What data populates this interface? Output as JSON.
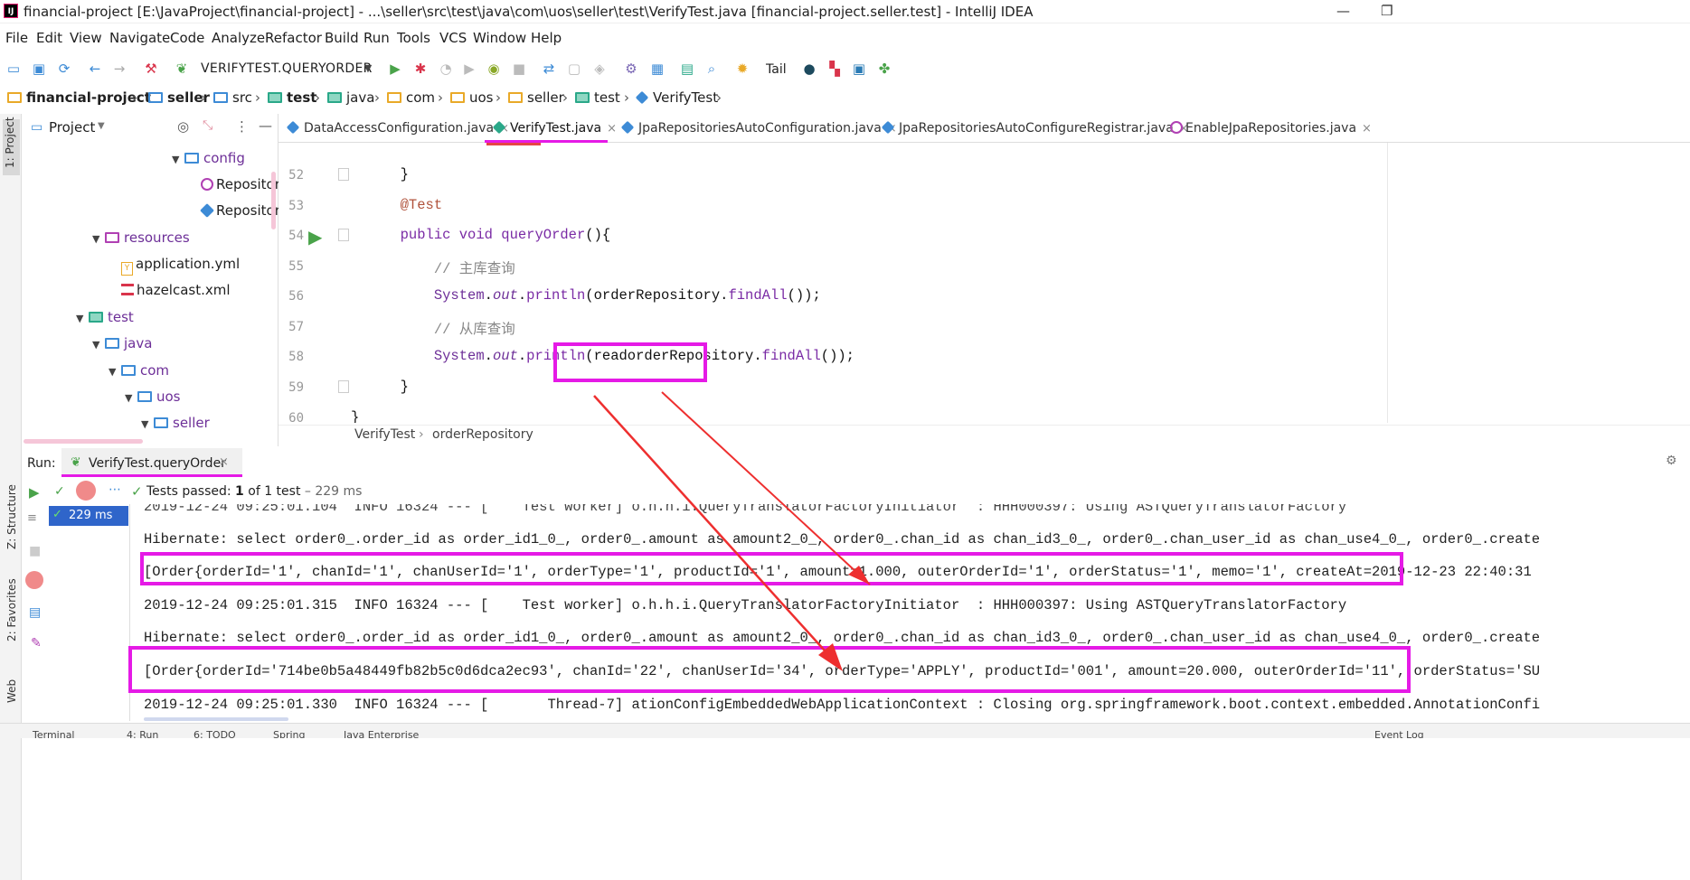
{
  "window": {
    "title": "financial-project [E:\\JavaProject\\financial-project] - ...\\seller\\src\\test\\java\\com\\uos\\seller\\test\\VerifyTest.java [financial-project.seller.test] - IntelliJ IDEA",
    "minimize": "—",
    "restore": "❐",
    "close": "✕"
  },
  "menu": [
    "File",
    "Edit",
    "View",
    "Navigate",
    "Code",
    "Analyze",
    "Refactor",
    "Build",
    "Run",
    "Tools",
    "VCS",
    "Window",
    "Help"
  ],
  "toolbar": {
    "run_config": "VERIFYTEST.QUERYORDER",
    "tail": "Tail"
  },
  "breadcrumb": [
    "financial-project",
    "seller",
    "src",
    "test",
    "java",
    "com",
    "uos",
    "seller",
    "test",
    "VerifyTest"
  ],
  "left_strip": {
    "project": "1: Project",
    "structure": "Z: Structure",
    "favorites": "2: Favorites",
    "web": "Web"
  },
  "project": {
    "header": "Project",
    "tree": [
      {
        "label": "config",
        "level": 6,
        "type": "folder",
        "expanded": true
      },
      {
        "label": "Repository",
        "level": 8,
        "type": "annotation"
      },
      {
        "label": "Repository",
        "level": 8,
        "type": "class"
      },
      {
        "label": "resources",
        "level": 4,
        "type": "folder",
        "expanded": true
      },
      {
        "label": "application.yml",
        "level": 6,
        "type": "yml"
      },
      {
        "label": "hazelcast.xml",
        "level": 6,
        "type": "xml"
      },
      {
        "label": "test",
        "level": 3,
        "type": "folder",
        "expanded": true
      },
      {
        "label": "java",
        "level": 4,
        "type": "folder",
        "expanded": true
      },
      {
        "label": "com",
        "level": 5,
        "type": "folder",
        "expanded": true
      },
      {
        "label": "uos",
        "level": 6,
        "type": "folder",
        "expanded": true
      },
      {
        "label": "seller",
        "level": 7,
        "type": "folder",
        "expanded": true
      }
    ]
  },
  "tabs": [
    {
      "label": "DataAccessConfiguration.java",
      "active": false
    },
    {
      "label": "VerifyTest.java",
      "active": true
    },
    {
      "label": "JpaRepositoriesAutoConfiguration.java",
      "active": false
    },
    {
      "label": "JpaRepositoriesAutoConfigureRegistrar.java",
      "active": false
    },
    {
      "label": "EnableJpaRepositories.java",
      "active": false
    }
  ],
  "editor": {
    "lines": [
      {
        "n": "52",
        "code": "}"
      },
      {
        "n": "53",
        "code": "@Test"
      },
      {
        "n": "54",
        "code": "public void queryOrder(){"
      },
      {
        "n": "55",
        "code": "// 主库查询"
      },
      {
        "n": "56",
        "code": "System.out.println(orderRepository.findAll());"
      },
      {
        "n": "57",
        "code": "// 从库查询"
      },
      {
        "n": "58",
        "code": "System.out.println(readorderRepository.findAll());"
      },
      {
        "n": "59",
        "code": "}"
      },
      {
        "n": "60",
        "code": "}"
      }
    ],
    "tokens": {
      "system": "System",
      "out": "out",
      "println": "println",
      "findall": "findAll",
      "repo1": "orderRepository",
      "repo2": "readorderRepository",
      "kw_public": "public",
      "kw_void": "void",
      "method": "queryOrder",
      "ann": "@Test",
      "cmt1": "// 主库查询",
      "cmt2": "// 从库查询"
    },
    "breadcrumbs": [
      "VerifyTest",
      "orderRepository"
    ]
  },
  "run": {
    "label": "Run:",
    "tab": "VerifyTest.queryOrder",
    "status_pre": "Tests passed: ",
    "status_bold": "1",
    "status_mid": " of 1 test",
    "status_time": " – 229 ms",
    "tree_time": "229 ms",
    "console": [
      "2019-12-24 09:25:01.104  INFO 16324 --- [    Test worker] o.h.h.i.QueryTranslatorFactoryInitiator  : HHH000397: Using ASTQueryTranslatorFactory",
      "Hibernate: select order0_.order_id as order_id1_0_, order0_.amount as amount2_0_, order0_.chan_id as chan_id3_0_, order0_.chan_user_id as chan_use4_0_, order0_.create",
      "[Order{orderId='1', chanId='1', chanUserId='1', orderType='1', productId='1', amount=1.000, outerOrderId='1', orderStatus='1', memo='1', createAt=2019-12-23 22:40:31",
      "2019-12-24 09:25:01.315  INFO 16324 --- [    Test worker] o.h.h.i.QueryTranslatorFactoryInitiator  : HHH000397: Using ASTQueryTranslatorFactory",
      "Hibernate: select order0_.order_id as order_id1_0_, order0_.amount as amount2_0_, order0_.chan_id as chan_id3_0_, order0_.chan_user_id as chan_use4_0_, order0_.create",
      "[Order{orderId='714be0b5a48449fb82b5c0d6dca2ec93', chanId='22', chanUserId='34', orderType='APPLY', productId='001', amount=20.000, outerOrderId='11', orderStatus='SU",
      "2019-12-24 09:25:01.330  INFO 16324 --- [       Thread-7] ationConfigEmbeddedWebApplicationContext : Closing org.springframework.boot.context.embedded.AnnotationConfi"
    ]
  },
  "bottom": [
    "Terminal",
    "4: Run",
    "6: TODO",
    "Spring",
    "Java Enterprise",
    "Event Log"
  ],
  "colors": {
    "highlight": "#e51ae6",
    "arrow": "#ee2f2f",
    "run_green": "#4aa34a",
    "selection": "#2f65ca"
  }
}
